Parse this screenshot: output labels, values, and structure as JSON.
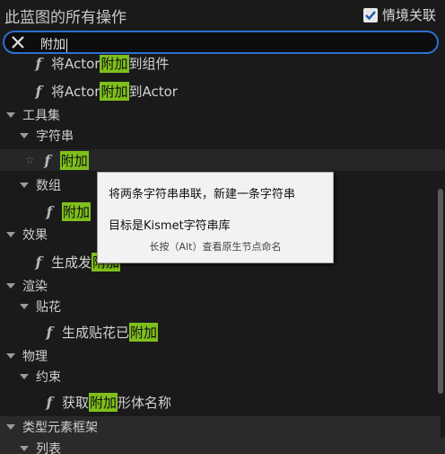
{
  "header": {
    "title": "此蓝图的所有操作",
    "context_label": "情境关联",
    "context_checked": true
  },
  "search": {
    "value": "附加"
  },
  "list": {
    "r1": {
      "pre": "将Actor",
      "hl": "附加",
      "post": "到组件"
    },
    "r2": {
      "pre": "将Actor",
      "hl": "附加",
      "post": "到Actor"
    },
    "cat_tools": "工具集",
    "cat_string": "字符串",
    "r_append": {
      "hl": "附加"
    },
    "cat_array": "数组",
    "r_array": {
      "hl": "附加"
    },
    "cat_effects": "效果",
    "r_effect": {
      "pre": "生成发",
      "hl": "附加"
    },
    "cat_render": "渲染",
    "cat_decal": "贴花",
    "r_decal": {
      "pre": "生成贴花已",
      "hl": "附加"
    },
    "cat_physics": "物理",
    "cat_constraint": "约束",
    "r_constraint": {
      "pre": "获取",
      "hl": "附加",
      "post": "形体名称"
    },
    "cat_type": "类型元素框架",
    "cat_list": "列表"
  },
  "tooltip": {
    "line1": "将两条字符串串联，新建一条字符串",
    "line2": "目标是Kismet字符串库",
    "line3": "长按（Alt）查看原生节点命名"
  }
}
